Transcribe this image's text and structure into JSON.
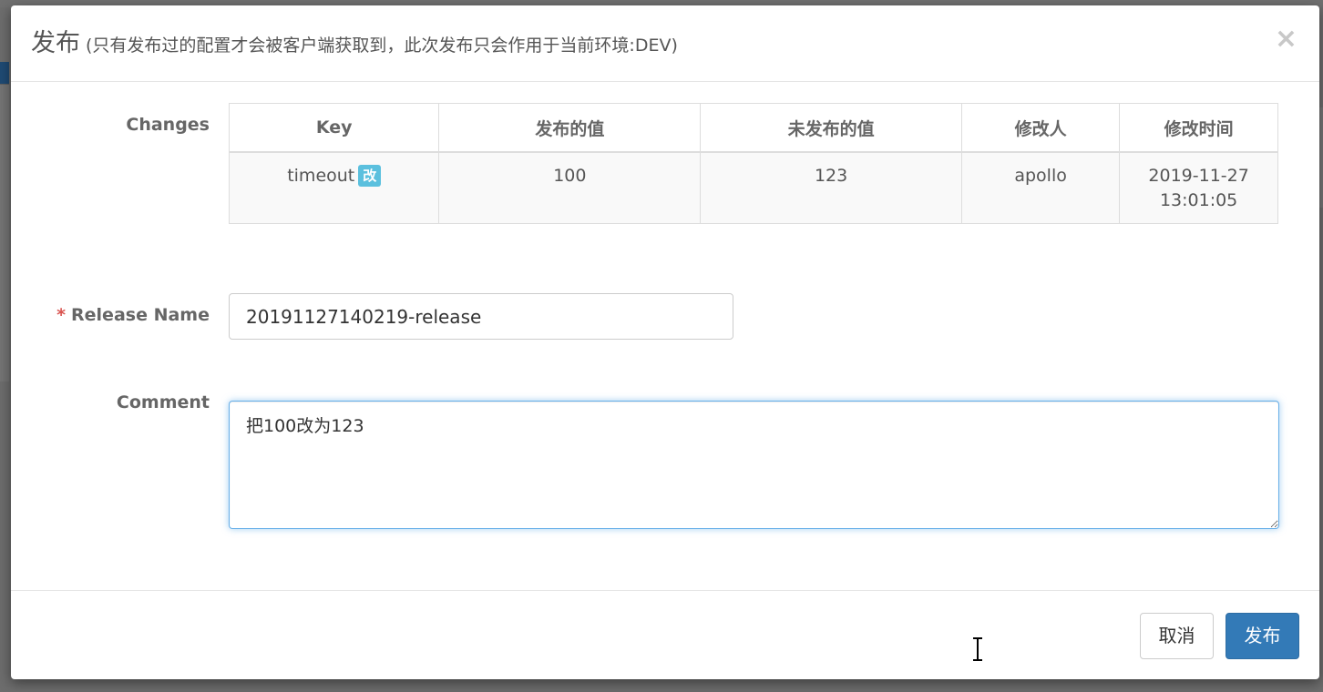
{
  "modal": {
    "title": "发布",
    "subtitle": "(只有发布过的配置才会被客户端获取到，此次发布只会作用于当前环境:DEV)",
    "close_label": "×"
  },
  "changes": {
    "label": "Changes",
    "columns": [
      "Key",
      "发布的值",
      "未发布的值",
      "修改人",
      "修改时间"
    ],
    "rows": [
      {
        "key": "timeout",
        "badge": "改",
        "released_value": "100",
        "unreleased_value": "123",
        "modifier": "apollo",
        "modified_time": "2019-11-27 13:01:05"
      }
    ]
  },
  "release_name": {
    "required_mark": "*",
    "label": "Release Name",
    "value": "20191127140219-release"
  },
  "comment": {
    "label": "Comment",
    "value": "把100改为123"
  },
  "footer": {
    "cancel_label": "取消",
    "publish_label": "发布"
  },
  "colors": {
    "primary": "#337ab7",
    "badge": "#5bc0de",
    "required": "#d9534f",
    "focus_border": "#66afe9"
  }
}
